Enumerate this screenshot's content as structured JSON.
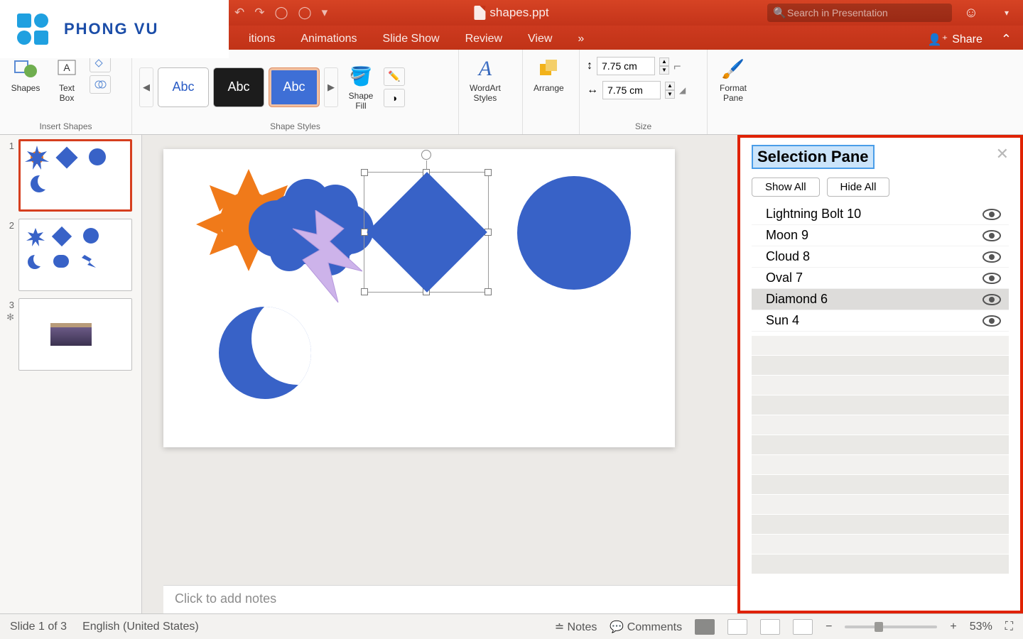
{
  "title_bar": {
    "filename": "shapes.ppt",
    "search_placeholder": "Search in Presentation"
  },
  "tabs": {
    "items": [
      "itions",
      "Animations",
      "Slide Show",
      "Review",
      "View",
      "»"
    ],
    "share": "Share"
  },
  "ribbon": {
    "insert_shapes": {
      "shapes": "Shapes",
      "textbox": "Text\nBox",
      "group": "Insert Shapes"
    },
    "shape_styles": {
      "abc": "Abc",
      "shape_fill": "Shape\nFill",
      "group": "Shape Styles"
    },
    "wordart": "WordArt\nStyles",
    "arrange": "Arrange",
    "size": {
      "w": "7.75 cm",
      "h": "7.75 cm",
      "group": "Size"
    },
    "format_pane": "Format\nPane"
  },
  "brand": "PHONG VU",
  "thumbs": {
    "n1": "1",
    "n2": "2",
    "n3": "3"
  },
  "notes_placeholder": "Click to add notes",
  "selection_pane": {
    "title": "Selection Pane",
    "show_all": "Show All",
    "hide_all": "Hide All",
    "items": [
      {
        "label": "Lightning Bolt 10"
      },
      {
        "label": "Moon 9"
      },
      {
        "label": "Cloud 8"
      },
      {
        "label": "Oval 7"
      },
      {
        "label": "Diamond 6",
        "selected": true
      },
      {
        "label": "Sun 4"
      }
    ]
  },
  "status": {
    "slide": "Slide 1 of 3",
    "lang": "English (United States)",
    "notes": "Notes",
    "comments": "Comments",
    "zoom": "53%"
  },
  "colors": {
    "accent": "#d64324",
    "shape_blue": "#3862c7",
    "sun": "#f07a1a",
    "bolt": "#c9b1ec"
  }
}
